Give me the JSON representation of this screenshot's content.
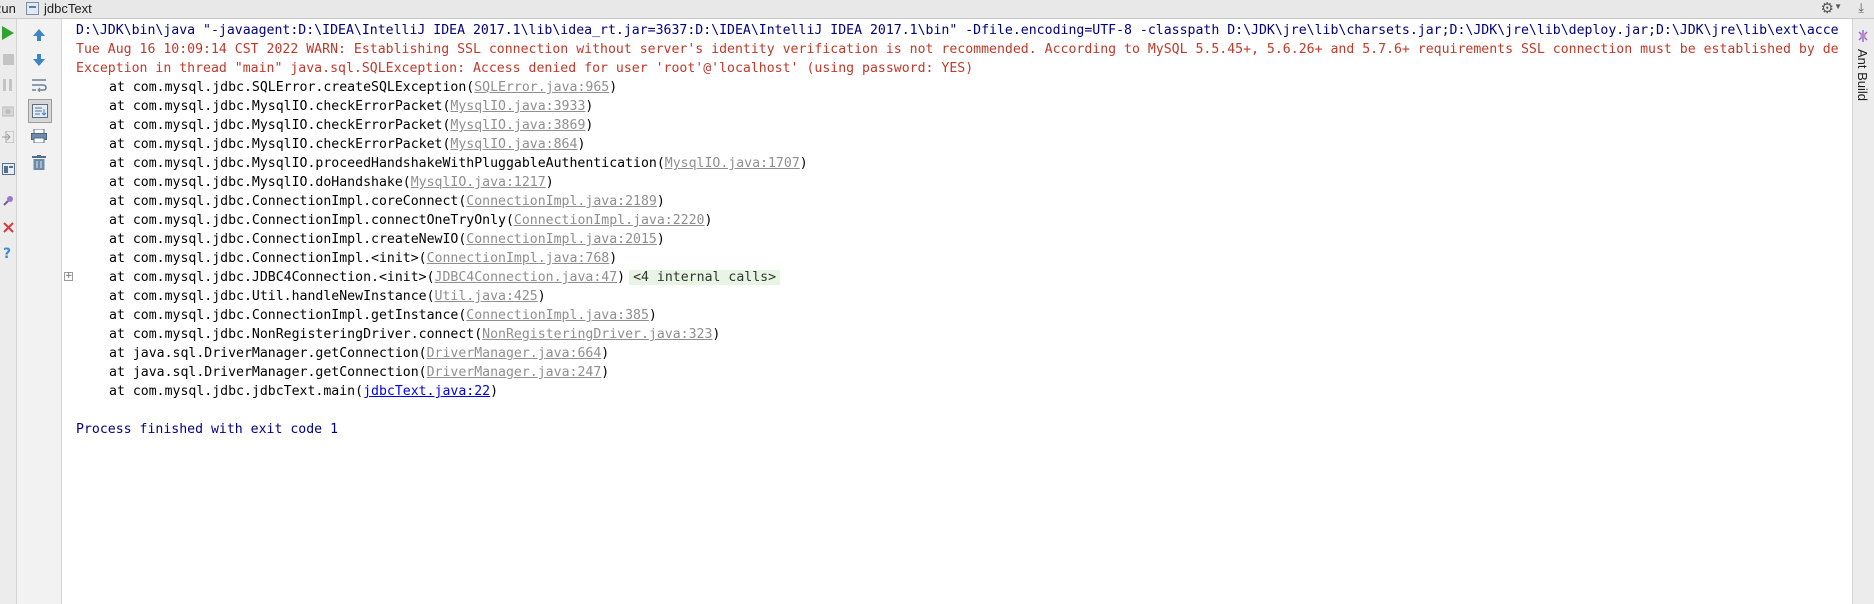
{
  "header": {
    "run_label": "Run",
    "tab_title": "jdbcText",
    "icons": [
      "gear-icon",
      "hide-icon"
    ]
  },
  "toolbar_left": {
    "buttons": [
      "rerun-icon",
      "stop-icon",
      "pause-icon",
      "dump-threads-icon",
      "exit-icon",
      "layout-icon",
      "pin-icon",
      "close-icon",
      "help-icon"
    ]
  },
  "toolbar_console": {
    "buttons": [
      "up-stack-icon",
      "down-stack-icon",
      "soft-wrap-icon",
      "scroll-to-end-icon",
      "print-icon",
      "clear-all-icon"
    ]
  },
  "console": {
    "command_line": "D:\\JDK\\bin\\java \"-javaagent:D:\\IDEA\\IntelliJ IDEA 2017.1\\lib\\idea_rt.jar=3637:D:\\IDEA\\IntelliJ IDEA 2017.1\\bin\" -Dfile.encoding=UTF-8 -classpath D:\\JDK\\jre\\lib\\charsets.jar;D:\\JDK\\jre\\lib\\deploy.jar;D:\\JDK\\jre\\lib\\ext\\acce",
    "warning_line": "Tue Aug 16 10:09:14 CST 2022 WARN: Establishing SSL connection without server's identity verification is not recommended. According to MySQL 5.5.45+, 5.6.26+ and 5.7.6+ requirements SSL connection must be established by de",
    "exception_line": "Exception in thread \"main\" java.sql.SQLException: Access denied for user 'root'@'localhost' (using password: YES)",
    "stack_trace": [
      {
        "method": "at com.mysql.jdbc.SQLError.createSQLException(",
        "location": "SQLError.java:965",
        "close": ")"
      },
      {
        "method": "at com.mysql.jdbc.MysqlIO.checkErrorPacket(",
        "location": "MysqlIO.java:3933",
        "close": ")"
      },
      {
        "method": "at com.mysql.jdbc.MysqlIO.checkErrorPacket(",
        "location": "MysqlIO.java:3869",
        "close": ")"
      },
      {
        "method": "at com.mysql.jdbc.MysqlIO.checkErrorPacket(",
        "location": "MysqlIO.java:864",
        "close": ")"
      },
      {
        "method": "at com.mysql.jdbc.MysqlIO.proceedHandshakeWithPluggableAuthentication(",
        "location": "MysqlIO.java:1707",
        "close": ")"
      },
      {
        "method": "at com.mysql.jdbc.MysqlIO.doHandshake(",
        "location": "MysqlIO.java:1217",
        "close": ")"
      },
      {
        "method": "at com.mysql.jdbc.ConnectionImpl.coreConnect(",
        "location": "ConnectionImpl.java:2189",
        "close": ")"
      },
      {
        "method": "at com.mysql.jdbc.ConnectionImpl.connectOneTryOnly(",
        "location": "ConnectionImpl.java:2220",
        "close": ")"
      },
      {
        "method": "at com.mysql.jdbc.ConnectionImpl.createNewIO(",
        "location": "ConnectionImpl.java:2015",
        "close": ")"
      },
      {
        "method": "at com.mysql.jdbc.ConnectionImpl.<init>(",
        "location": "ConnectionImpl.java:768",
        "close": ")"
      },
      {
        "method": "at com.mysql.jdbc.JDBC4Connection.<init>(",
        "location": "JDBC4Connection.java:47",
        "close": ")",
        "folded": "<4 internal calls>"
      },
      {
        "method": "at com.mysql.jdbc.Util.handleNewInstance(",
        "location": "Util.java:425",
        "close": ")"
      },
      {
        "method": "at com.mysql.jdbc.ConnectionImpl.getInstance(",
        "location": "ConnectionImpl.java:385",
        "close": ")"
      },
      {
        "method": "at com.mysql.jdbc.NonRegisteringDriver.connect(",
        "location": "NonRegisteringDriver.java:323",
        "close": ")"
      },
      {
        "method": "at java.sql.DriverManager.getConnection(",
        "location": "DriverManager.java:664",
        "close": ")"
      },
      {
        "method": "at java.sql.DriverManager.getConnection(",
        "location": "DriverManager.java:247",
        "close": ")"
      },
      {
        "method": "at com.mysql.jdbc.jdbcText.main(",
        "location": "jdbcText.java:22",
        "close": ")",
        "user_code": true
      }
    ],
    "exit_line": "Process finished with exit code 1"
  },
  "right_strip": {
    "label": "Ant Build"
  }
}
